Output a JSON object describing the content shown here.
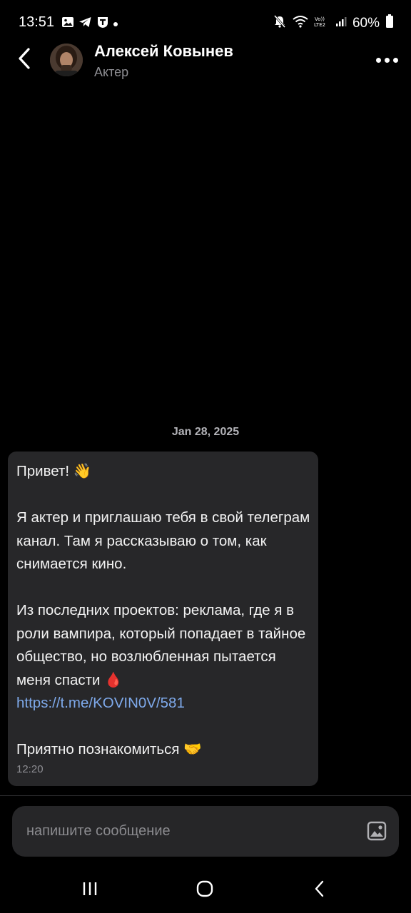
{
  "status_bar": {
    "time": "13:51",
    "battery": "60%",
    "left_icons": [
      "gallery-icon",
      "telegram-icon",
      "vpn-shield-icon"
    ],
    "right_icons": [
      "mute-icon",
      "wifi-icon",
      "volte-icon",
      "signal-icon",
      "battery-icon"
    ]
  },
  "header": {
    "name": "Алексей Ковынев",
    "subtitle": "Актер"
  },
  "date_separator": "Jan 28, 2025",
  "message": {
    "greeting": "Привет! 👋",
    "paragraph_1": "Я актер и приглашаю тебя в свой телеграм канал. Там я рассказываю о том, как снимается кино.",
    "paragraph_2": "Из последних проектов: реклама, где я в роли вампира, который попадает в тайное общество, но возлюбленная пытается меня спасти 🩸",
    "link": "https://t.me/KOVIN0V/581",
    "closing": "Приятно познакомиться 🤝",
    "time": "12:20"
  },
  "composer": {
    "placeholder": "напишите сообщение"
  },
  "colors": {
    "background": "#000000",
    "bubble": "#272729",
    "link": "#7ea9ea",
    "muted": "#8e8e93"
  }
}
